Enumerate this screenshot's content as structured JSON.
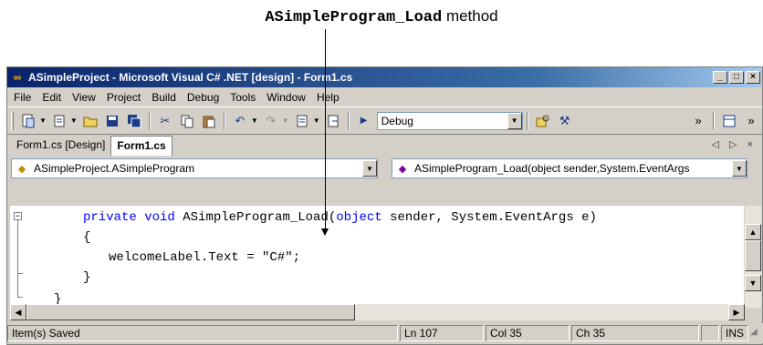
{
  "caption": {
    "code": "ASimpleProgram_Load",
    "text": "method"
  },
  "window": {
    "title": "ASimpleProject - Microsoft Visual C# .NET [design] - Form1.cs",
    "controls": [
      "_",
      "□",
      "×"
    ]
  },
  "menu": [
    "File",
    "Edit",
    "View",
    "Project",
    "Build",
    "Debug",
    "Tools",
    "Window",
    "Help"
  ],
  "toolbar": {
    "config_value": "Debug",
    "overflow": "»"
  },
  "tabs": [
    {
      "label": "Form1.cs [Design]",
      "active": false
    },
    {
      "label": "Form1.cs",
      "active": true
    }
  ],
  "tab_controls": "◁ ▷ ×",
  "navbar": {
    "class_combo": "ASimpleProject.ASimpleProgram",
    "member_combo": "ASimpleProgram_Load(object sender,System.EventArgs"
  },
  "code": {
    "line1_kw1": "private",
    "line1_kw2": "void",
    "line1_name": "ASimpleProgram_Load(",
    "line1_kw3": "object",
    "line1_rest": " sender, System.EventArgs e)",
    "line2": "{",
    "line3": "welcomeLabel.Text = \"C#\";",
    "line4": "}",
    "line5": "}"
  },
  "status": {
    "message": "Item(s) Saved",
    "line": "Ln 107",
    "col": "Col 35",
    "ch": "Ch 35",
    "mode": "INS"
  }
}
